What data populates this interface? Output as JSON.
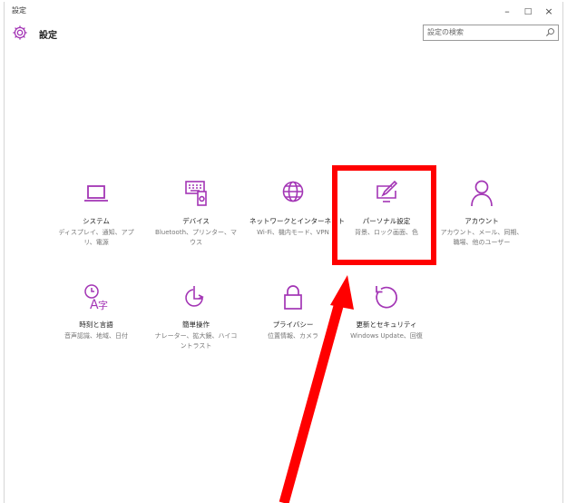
{
  "window": {
    "title": "設定",
    "controls": {
      "minimize": "–",
      "maximize": "□",
      "close": "×"
    }
  },
  "header": {
    "title": "設定"
  },
  "search": {
    "placeholder": "設定の検索"
  },
  "tiles": [
    {
      "icon": "laptop-icon",
      "name": "システム",
      "desc": "ディスプレイ、通知、アプリ、電源"
    },
    {
      "icon": "devices-icon",
      "name": "デバイス",
      "desc": "Bluetooth、プリンター、マウス"
    },
    {
      "icon": "globe-icon",
      "name": "ネットワークとインターネット",
      "desc": "Wi-Fi、機内モード、VPN"
    },
    {
      "icon": "personalization-icon",
      "name": "パーソナル設定",
      "desc": "背景、ロック画面、色"
    },
    {
      "icon": "person-icon",
      "name": "アカウント",
      "desc": "アカウント、メール、同期、職場、他のユーザー"
    },
    {
      "icon": "time-language-icon",
      "name": "時刻と言語",
      "desc": "音声認識、地域、日付"
    },
    {
      "icon": "ease-of-access-icon",
      "name": "簡単操作",
      "desc": "ナレーター、拡大鏡、ハイコントラスト"
    },
    {
      "icon": "lock-icon",
      "name": "プライバシー",
      "desc": "位置情報、カメラ"
    },
    {
      "icon": "update-icon",
      "name": "更新とセキュリティ",
      "desc": "Windows Update、回復"
    }
  ],
  "colors": {
    "accent": "#a335b5",
    "annotation": "#ff0000"
  }
}
